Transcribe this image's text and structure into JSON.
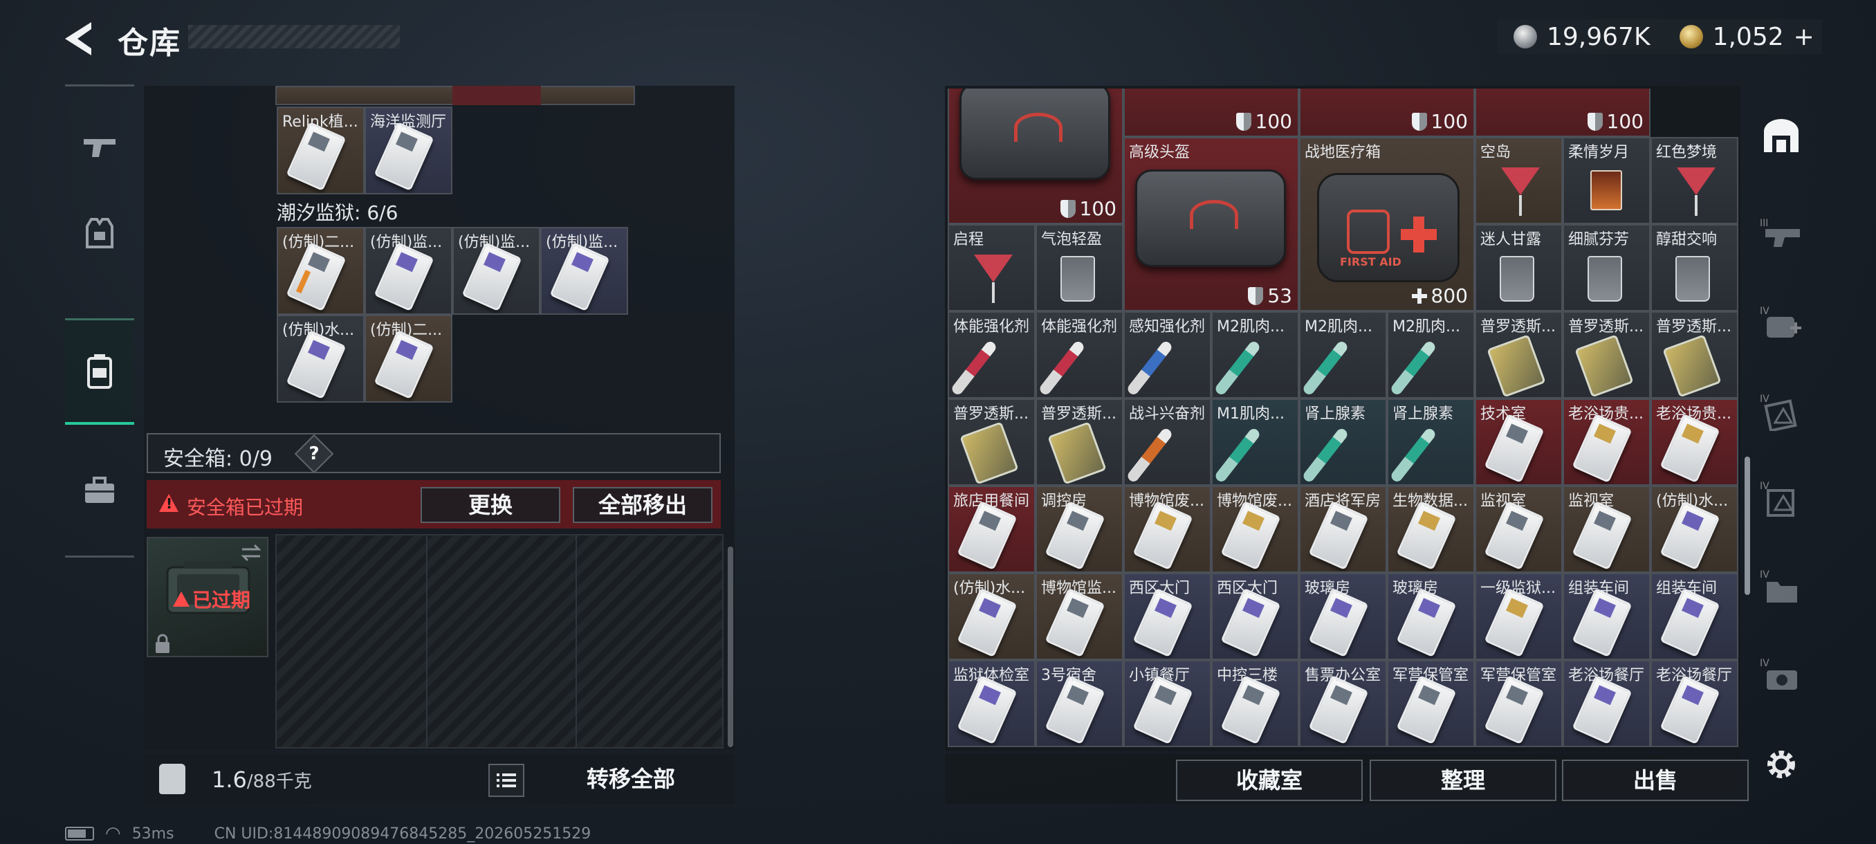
{
  "header": {
    "title": "仓库",
    "silver_amount": "19,967K",
    "gold_amount": "1,052",
    "gold_plus": "+"
  },
  "left": {
    "top_items": [
      {
        "label": "Relink植...",
        "bg": "brown",
        "icon": "keycard"
      },
      {
        "label": "海洋监测厅",
        "bg": "navy",
        "icon": "keycard"
      }
    ],
    "tide_prison_label": "潮汐监狱: 6/6",
    "tide_items": [
      {
        "label": "(仿制)二...",
        "bg": "brown",
        "icon": "keycard-orange"
      },
      {
        "label": "(仿制)监...",
        "bg": "grey",
        "icon": "keycard-purple"
      },
      {
        "label": "(仿制)监...",
        "bg": "grey",
        "icon": "keycard-purple"
      },
      {
        "label": "(仿制)监...",
        "bg": "navy",
        "icon": "keycard-purple"
      },
      {
        "label": "(仿制)水...",
        "bg": "grey",
        "icon": "keycard-purple"
      },
      {
        "label": "(仿制)二...",
        "bg": "brown",
        "icon": "keycard-purple"
      }
    ],
    "safebox_label": "安全箱: 0/9",
    "help_mark": "?",
    "expired_warning": "安全箱已过期",
    "replace_button": "更换",
    "move_out_all_button": "全部移出",
    "expired_badge": "已过期",
    "weight_current": "1.6",
    "weight_max": "/88千克",
    "transfer_all_button": "转移全部"
  },
  "status": {
    "ping": "53ms",
    "uid": "CN UID:8144890908947684528​5_202605251529"
  },
  "right": {
    "cells": [
      {
        "r": 0,
        "c": 0,
        "w": 2,
        "h": 2,
        "label": "",
        "bg": "red",
        "icon": "bag",
        "num": "100",
        "num_icon": "shield"
      },
      {
        "r": 0,
        "c": 2,
        "w": 2,
        "h": 1,
        "label": "",
        "bg": "red",
        "icon": "",
        "num": "100",
        "num_icon": "shield"
      },
      {
        "r": 0,
        "c": 4,
        "w": 2,
        "h": 1,
        "label": "",
        "bg": "red",
        "icon": "",
        "num": "100",
        "num_icon": "shield"
      },
      {
        "r": 0,
        "c": 6,
        "w": 2,
        "h": 1,
        "label": "",
        "bg": "red",
        "icon": "",
        "num": "100",
        "num_icon": "shield"
      },
      {
        "r": 1,
        "c": 2,
        "w": 2,
        "h": 2,
        "label": "高级头盔",
        "bg": "red",
        "icon": "bag",
        "num": "53",
        "num_icon": "shield"
      },
      {
        "r": 1,
        "c": 4,
        "w": 2,
        "h": 2,
        "label": "战地医疗箱",
        "bg": "brown",
        "icon": "medkit",
        "num": "800",
        "num_icon": "plus"
      },
      {
        "r": 1,
        "c": 6,
        "w": 1,
        "h": 1,
        "label": "空岛",
        "bg": "brown",
        "icon": "cocktail",
        "num": "",
        "num_icon": ""
      },
      {
        "r": 1,
        "c": 7,
        "w": 1,
        "h": 1,
        "label": "柔情岁月",
        "bg": "grey",
        "icon": "tumbler",
        "num": "",
        "num_icon": ""
      },
      {
        "r": 1,
        "c": 8,
        "w": 1,
        "h": 1,
        "label": "红色梦境",
        "bg": "grey",
        "icon": "cocktail",
        "num": "",
        "num_icon": ""
      },
      {
        "r": 2,
        "c": 0,
        "w": 1,
        "h": 1,
        "label": "启程",
        "bg": "grey",
        "icon": "cocktail",
        "num": "",
        "num_icon": ""
      },
      {
        "r": 2,
        "c": 1,
        "w": 1,
        "h": 1,
        "label": "气泡轻盈",
        "bg": "grey",
        "icon": "glass",
        "num": "",
        "num_icon": ""
      },
      {
        "r": 2,
        "c": 6,
        "w": 1,
        "h": 1,
        "label": "迷人甘露",
        "bg": "grey",
        "icon": "glass",
        "num": "",
        "num_icon": ""
      },
      {
        "r": 2,
        "c": 7,
        "w": 1,
        "h": 1,
        "label": "细腻芬芳",
        "bg": "grey",
        "icon": "glass",
        "num": "",
        "num_icon": ""
      },
      {
        "r": 2,
        "c": 8,
        "w": 1,
        "h": 1,
        "label": "醇甜交响",
        "bg": "grey",
        "icon": "glass",
        "num": "",
        "num_icon": ""
      },
      {
        "r": 3,
        "c": 0,
        "w": 1,
        "h": 1,
        "label": "体能强化剂",
        "bg": "grey",
        "icon": "syringe",
        "num": "",
        "num_icon": ""
      },
      {
        "r": 3,
        "c": 1,
        "w": 1,
        "h": 1,
        "label": "体能强化剂",
        "bg": "grey",
        "icon": "syringe",
        "num": "",
        "num_icon": ""
      },
      {
        "r": 3,
        "c": 2,
        "w": 1,
        "h": 1,
        "label": "感知强化剂",
        "bg": "grey",
        "icon": "syringe-blue",
        "num": "",
        "num_icon": ""
      },
      {
        "r": 3,
        "c": 3,
        "w": 1,
        "h": 1,
        "label": "M2肌肉...",
        "bg": "grey",
        "icon": "syringe-teal",
        "num": "",
        "num_icon": ""
      },
      {
        "r": 3,
        "c": 4,
        "w": 1,
        "h": 1,
        "label": "M2肌肉...",
        "bg": "grey",
        "icon": "syringe-teal",
        "num": "",
        "num_icon": ""
      },
      {
        "r": 3,
        "c": 5,
        "w": 1,
        "h": 1,
        "label": "M2肌肉...",
        "bg": "grey",
        "icon": "syringe-teal",
        "num": "",
        "num_icon": ""
      },
      {
        "r": 3,
        "c": 6,
        "w": 1,
        "h": 1,
        "label": "普罗透斯...",
        "bg": "grey",
        "icon": "blister",
        "num": "",
        "num_icon": ""
      },
      {
        "r": 3,
        "c": 7,
        "w": 1,
        "h": 1,
        "label": "普罗透斯...",
        "bg": "grey",
        "icon": "blister",
        "num": "",
        "num_icon": ""
      },
      {
        "r": 3,
        "c": 8,
        "w": 1,
        "h": 1,
        "label": "普罗透斯...",
        "bg": "grey",
        "icon": "blister",
        "num": "",
        "num_icon": ""
      },
      {
        "r": 4,
        "c": 0,
        "w": 1,
        "h": 1,
        "label": "普罗透斯...",
        "bg": "grey",
        "icon": "blister",
        "num": "",
        "num_icon": ""
      },
      {
        "r": 4,
        "c": 1,
        "w": 1,
        "h": 1,
        "label": "普罗透斯...",
        "bg": "grey",
        "icon": "blister",
        "num": "",
        "num_icon": ""
      },
      {
        "r": 4,
        "c": 2,
        "w": 1,
        "h": 1,
        "label": "战斗兴奋剂",
        "bg": "grey",
        "icon": "syringe-orange",
        "num": "",
        "num_icon": ""
      },
      {
        "r": 4,
        "c": 3,
        "w": 1,
        "h": 1,
        "label": "M1肌肉...",
        "bg": "teal",
        "icon": "syringe-teal",
        "num": "",
        "num_icon": ""
      },
      {
        "r": 4,
        "c": 4,
        "w": 1,
        "h": 1,
        "label": "肾上腺素",
        "bg": "teal",
        "icon": "syringe-teal",
        "num": "",
        "num_icon": ""
      },
      {
        "r": 4,
        "c": 5,
        "w": 1,
        "h": 1,
        "label": "肾上腺素",
        "bg": "teal",
        "icon": "syringe-teal",
        "num": "",
        "num_icon": ""
      },
      {
        "r": 4,
        "c": 6,
        "w": 1,
        "h": 1,
        "label": "技术室",
        "bg": "red",
        "icon": "keycard",
        "num": "",
        "num_icon": ""
      },
      {
        "r": 4,
        "c": 7,
        "w": 1,
        "h": 1,
        "label": "老浴场贵...",
        "bg": "red",
        "icon": "keycard-gold",
        "num": "",
        "num_icon": ""
      },
      {
        "r": 4,
        "c": 8,
        "w": 1,
        "h": 1,
        "label": "老浴场贵...",
        "bg": "red",
        "icon": "keycard-gold",
        "num": "",
        "num_icon": ""
      },
      {
        "r": 5,
        "c": 0,
        "w": 1,
        "h": 1,
        "label": "旅店用餐间",
        "bg": "red",
        "icon": "keycard",
        "num": "",
        "num_icon": ""
      },
      {
        "r": 5,
        "c": 1,
        "w": 1,
        "h": 1,
        "label": "调控房",
        "bg": "brown",
        "icon": "keycard",
        "num": "",
        "num_icon": ""
      },
      {
        "r": 5,
        "c": 2,
        "w": 1,
        "h": 1,
        "label": "博物馆废...",
        "bg": "brown",
        "icon": "keycard-gold",
        "num": "",
        "num_icon": ""
      },
      {
        "r": 5,
        "c": 3,
        "w": 1,
        "h": 1,
        "label": "博物馆废...",
        "bg": "brown",
        "icon": "keycard-gold",
        "num": "",
        "num_icon": ""
      },
      {
        "r": 5,
        "c": 4,
        "w": 1,
        "h": 1,
        "label": "酒店将军房",
        "bg": "brown",
        "icon": "keycard",
        "num": "",
        "num_icon": ""
      },
      {
        "r": 5,
        "c": 5,
        "w": 1,
        "h": 1,
        "label": "生物数据...",
        "bg": "brown",
        "icon": "keycard-gold",
        "num": "",
        "num_icon": ""
      },
      {
        "r": 5,
        "c": 6,
        "w": 1,
        "h": 1,
        "label": "监视室",
        "bg": "brown",
        "icon": "keycard",
        "num": "",
        "num_icon": ""
      },
      {
        "r": 5,
        "c": 7,
        "w": 1,
        "h": 1,
        "label": "监视室",
        "bg": "brown",
        "icon": "keycard",
        "num": "",
        "num_icon": ""
      },
      {
        "r": 5,
        "c": 8,
        "w": 1,
        "h": 1,
        "label": "(仿制)水...",
        "bg": "brown",
        "icon": "keycard-purple",
        "num": "",
        "num_icon": ""
      },
      {
        "r": 6,
        "c": 0,
        "w": 1,
        "h": 1,
        "label": "(仿制)水...",
        "bg": "brown",
        "icon": "keycard-purple",
        "num": "",
        "num_icon": ""
      },
      {
        "r": 6,
        "c": 1,
        "w": 1,
        "h": 1,
        "label": "博物馆监...",
        "bg": "brown",
        "icon": "keycard",
        "num": "",
        "num_icon": ""
      },
      {
        "r": 6,
        "c": 2,
        "w": 1,
        "h": 1,
        "label": "西区大门",
        "bg": "navy",
        "icon": "keycard-purple",
        "num": "",
        "num_icon": ""
      },
      {
        "r": 6,
        "c": 3,
        "w": 1,
        "h": 1,
        "label": "西区大门",
        "bg": "navy",
        "icon": "keycard-purple",
        "num": "",
        "num_icon": ""
      },
      {
        "r": 6,
        "c": 4,
        "w": 1,
        "h": 1,
        "label": "玻璃房",
        "bg": "navy",
        "icon": "keycard-purple",
        "num": "",
        "num_icon": ""
      },
      {
        "r": 6,
        "c": 5,
        "w": 1,
        "h": 1,
        "label": "玻璃房",
        "bg": "navy",
        "icon": "keycard-purple",
        "num": "",
        "num_icon": ""
      },
      {
        "r": 6,
        "c": 6,
        "w": 1,
        "h": 1,
        "label": "一级监狱...",
        "bg": "navy",
        "icon": "keycard-gold",
        "num": "",
        "num_icon": ""
      },
      {
        "r": 6,
        "c": 7,
        "w": 1,
        "h": 1,
        "label": "组装车间",
        "bg": "navy",
        "icon": "keycard-purple",
        "num": "",
        "num_icon": ""
      },
      {
        "r": 6,
        "c": 8,
        "w": 1,
        "h": 1,
        "label": "组装车间",
        "bg": "navy",
        "icon": "keycard-purple",
        "num": "",
        "num_icon": ""
      },
      {
        "r": 7,
        "c": 0,
        "w": 1,
        "h": 1,
        "label": "监狱体检室",
        "bg": "navy",
        "icon": "keycard-purple",
        "num": "",
        "num_icon": ""
      },
      {
        "r": 7,
        "c": 1,
        "w": 1,
        "h": 1,
        "label": "3号宿舍",
        "bg": "navy",
        "icon": "keycard",
        "num": "",
        "num_icon": ""
      },
      {
        "r": 7,
        "c": 2,
        "w": 1,
        "h": 1,
        "label": "小镇餐厅",
        "bg": "navy",
        "icon": "keycard",
        "num": "",
        "num_icon": ""
      },
      {
        "r": 7,
        "c": 3,
        "w": 1,
        "h": 1,
        "label": "中控三楼",
        "bg": "navy",
        "icon": "keycard",
        "num": "",
        "num_icon": ""
      },
      {
        "r": 7,
        "c": 4,
        "w": 1,
        "h": 1,
        "label": "售票办公室",
        "bg": "navy",
        "icon": "keycard",
        "num": "",
        "num_icon": ""
      },
      {
        "r": 7,
        "c": 5,
        "w": 1,
        "h": 1,
        "label": "军营保管室",
        "bg": "navy",
        "icon": "keycard",
        "num": "",
        "num_icon": ""
      },
      {
        "r": 7,
        "c": 6,
        "w": 1,
        "h": 1,
        "label": "军营保管室",
        "bg": "navy",
        "icon": "keycard",
        "num": "",
        "num_icon": ""
      },
      {
        "r": 7,
        "c": 7,
        "w": 1,
        "h": 1,
        "label": "老浴场餐厅",
        "bg": "navy",
        "icon": "keycard-purple",
        "num": "",
        "num_icon": ""
      },
      {
        "r": 7,
        "c": 8,
        "w": 1,
        "h": 1,
        "label": "老浴场餐厅",
        "bg": "navy",
        "icon": "keycard-purple",
        "num": "",
        "num_icon": ""
      }
    ],
    "collection_button": "收藏室",
    "sort_button": "整理",
    "sell_button": "出售"
  },
  "right_nav_icons": [
    "storage-home-icon",
    "tier3-weapon-icon",
    "tier4-medical-icon",
    "tier4-keycard-icon",
    "tier4-keycard-icon",
    "tier4-folder-icon",
    "tier4-gear-icon"
  ]
}
